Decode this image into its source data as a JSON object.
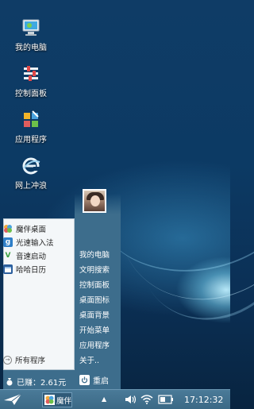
{
  "desktop": {
    "icons": [
      {
        "label": "我的电脑",
        "icon": "my-computer-icon"
      },
      {
        "label": "控制面板",
        "icon": "control-panel-icon"
      },
      {
        "label": "应用程序",
        "icon": "applications-icon"
      },
      {
        "label": "网上冲浪",
        "icon": "internet-browser-icon"
      }
    ]
  },
  "start_menu": {
    "left_items": [
      {
        "label": "魔伴桌面",
        "icon": "pinwheel-icon"
      },
      {
        "label": "光速输入法",
        "icon": "input-method-icon"
      },
      {
        "label": "音速启动",
        "icon": "v-launcher-icon"
      },
      {
        "label": "哈哈日历",
        "icon": "calendar-icon"
      }
    ],
    "all_programs": "所有程序",
    "right_items": [
      "我的电脑",
      "文明搜索",
      "控制面板",
      "桌面图标",
      "桌面背景",
      "开始菜单",
      "应用程序",
      "关于.."
    ],
    "earned": "已赚：2.61元",
    "restart": "重启"
  },
  "taskbar": {
    "task_label": "魔伴",
    "clock": "17:12:32"
  }
}
